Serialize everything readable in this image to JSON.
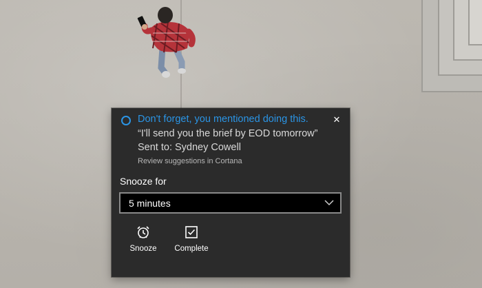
{
  "notification": {
    "title": "Don't forget, you mentioned doing this.",
    "quote": "“I'll send you the brief by EOD tomorrow”",
    "sent_to": "Sent to: Sydney Cowell",
    "review_link": "Review suggestions in Cortana",
    "snooze_label": "Snooze for",
    "snooze_selected": "5 minutes",
    "actions": [
      {
        "label": "Snooze",
        "icon": "alarm-clock-icon"
      },
      {
        "label": "Complete",
        "icon": "checkbox-checked-icon"
      }
    ],
    "close_icon": "close-icon",
    "accent_color": "#2b95e6",
    "background_color": "#2b2b2b"
  }
}
